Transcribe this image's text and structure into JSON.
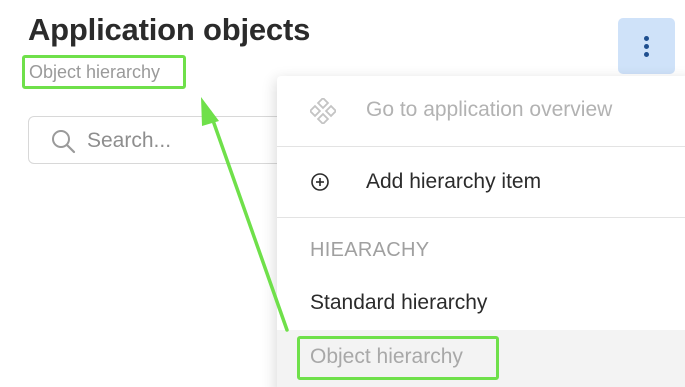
{
  "header": {
    "title": "Application objects",
    "breadcrumb": "Object hierarchy"
  },
  "search": {
    "placeholder": "Search..."
  },
  "menu_button": {
    "icon": "kebab-menu-icon"
  },
  "dropdown": {
    "items": [
      {
        "label": "Go to application overview",
        "icon": "overview-icon",
        "disabled": true
      },
      {
        "label": "Add hierarchy item",
        "icon": "plus-circle-icon",
        "disabled": false
      }
    ],
    "section_header": "HIEARACHY",
    "hierarchy_items": [
      {
        "label": "Standard hierarchy",
        "selected": false
      },
      {
        "label": "Object hierarchy",
        "selected": true
      }
    ]
  },
  "colors": {
    "accent_bg": "#cfe2f9",
    "accent_fg": "#1f4f8f",
    "annotation": "#6fe04a"
  }
}
